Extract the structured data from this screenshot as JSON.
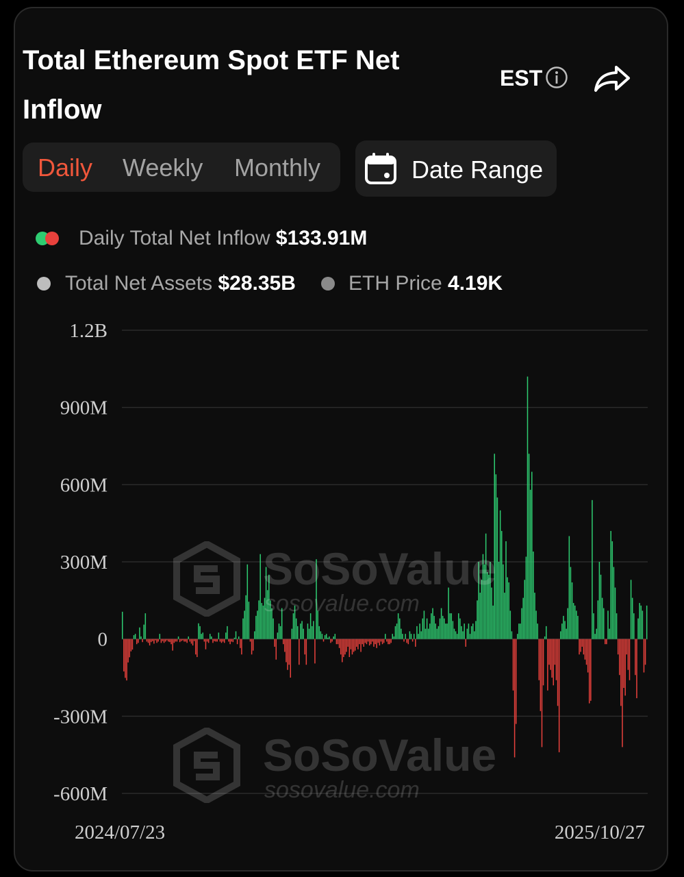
{
  "header": {
    "title": "Total Ethereum Spot ETF Net Inflow",
    "timezone": "EST"
  },
  "controls": {
    "periods": [
      "Daily",
      "Weekly",
      "Monthly"
    ],
    "active_period": "Daily",
    "date_range_label": "Date Range"
  },
  "legend": {
    "net_inflow_label": "Daily Total Net Inflow",
    "net_inflow_value": "$133.91M",
    "assets_label": "Total Net Assets",
    "assets_value": "$28.35B",
    "price_label": "ETH Price",
    "price_value": "4.19K"
  },
  "watermark": {
    "brand": "SoSoValue",
    "site": "sosovalue.com"
  },
  "colors": {
    "positive": "#2ecc71",
    "negative": "#e8413c",
    "accent": "#f0573b"
  },
  "chart_data": {
    "type": "bar",
    "ylim": [
      -600000000,
      1200000000
    ],
    "y_ticks": [
      {
        "value": 1200000000,
        "label": "1.2B"
      },
      {
        "value": 900000000,
        "label": "900M"
      },
      {
        "value": 600000000,
        "label": "600M"
      },
      {
        "value": 300000000,
        "label": "300M"
      },
      {
        "value": 0,
        "label": "0"
      },
      {
        "value": -300000000,
        "label": "-300M"
      },
      {
        "value": -600000000,
        "label": "-600M"
      }
    ],
    "x_start": "2024/07/23",
    "x_end": "2025/10/27",
    "grid": true,
    "values": [
      106,
      -126,
      -151,
      -161,
      -91,
      -71,
      -48,
      -41,
      15,
      20,
      -20,
      -15,
      45,
      10,
      -12,
      56,
      100,
      -10,
      -15,
      -25,
      -12,
      -8,
      -18,
      -5,
      -15,
      -10,
      20,
      -15,
      -8,
      -15,
      -10,
      -5,
      -10,
      -12,
      -20,
      -45,
      -15,
      -10,
      -10,
      10,
      -12,
      -8,
      -5,
      -10,
      -10,
      -15,
      10,
      -10,
      -18,
      -25,
      -8,
      -60,
      -70,
      61,
      50,
      20,
      25,
      -10,
      -40,
      -10,
      -15,
      20,
      10,
      -15,
      -8,
      -10,
      -10,
      25,
      -10,
      -15,
      -10,
      -15,
      25,
      50,
      -10,
      -20,
      -10,
      -12,
      5,
      30,
      -20,
      10,
      -35,
      -60,
      80,
      110,
      170,
      290,
      145,
      -10,
      -60,
      -45,
      30,
      90,
      110,
      150,
      330,
      140,
      130,
      160,
      280,
      190,
      250,
      150,
      120,
      80,
      -30,
      -80,
      25,
      60,
      50,
      120,
      -20,
      -50,
      -90,
      -120,
      -100,
      -150,
      40,
      100,
      130,
      80,
      50,
      -100,
      60,
      70,
      40,
      -60,
      -100,
      60,
      40,
      100,
      50,
      70,
      -95,
      310,
      110,
      50,
      30,
      20,
      -10,
      15,
      20,
      5,
      10,
      -15,
      -10,
      10,
      20,
      -20,
      -20,
      -35,
      -60,
      -90,
      -70,
      -60,
      -50,
      -30,
      -70,
      -40,
      -60,
      -50,
      -45,
      -30,
      -40,
      -20,
      -50,
      -20,
      -30,
      -15,
      -20,
      -10,
      -25,
      -20,
      -10,
      -30,
      -20,
      -35,
      -15,
      -25,
      -10,
      -20,
      -15,
      20,
      -10,
      -20,
      -20,
      -15,
      20,
      10,
      50,
      60,
      100,
      80,
      40,
      20,
      -10,
      20,
      -15,
      -20,
      30,
      20,
      -10,
      20,
      -30,
      50,
      20,
      60,
      30,
      80,
      110,
      40,
      80,
      40,
      60,
      100,
      120,
      90,
      60,
      40,
      50,
      80,
      120,
      90,
      80,
      60,
      60,
      200,
      100,
      100,
      70,
      40,
      30,
      20,
      100,
      80,
      50,
      30,
      60,
      -30,
      40,
      60,
      20,
      50,
      60,
      30,
      70,
      150,
      300,
      180,
      230,
      330,
      290,
      410,
      260,
      250,
      300,
      200,
      130,
      720,
      640,
      550,
      300,
      500,
      420,
      290,
      180,
      380,
      240,
      220,
      110,
      30,
      -200,
      -460,
      -330,
      20,
      60,
      60,
      120,
      160,
      230,
      320,
      1020,
      720,
      580,
      650,
      340,
      180,
      110,
      60,
      -160,
      -280,
      -420,
      -180,
      10,
      50,
      -200,
      -100,
      -120,
      -150,
      -180,
      -100,
      -160,
      -260,
      -440,
      30,
      60,
      90,
      70,
      40,
      120,
      400,
      280,
      220,
      140,
      130,
      110,
      90,
      -60,
      -50,
      -30,
      -60,
      -80,
      -100,
      -130,
      -250,
      -240,
      540,
      100,
      20,
      40,
      150,
      300,
      250,
      160,
      120,
      -20,
      -20,
      110,
      40,
      420,
      380,
      280,
      200,
      100,
      -60,
      -140,
      -260,
      -420,
      -190,
      -220,
      -60,
      -120,
      -160,
      230,
      160,
      100,
      -140,
      -230,
      80,
      140,
      130,
      110,
      -130,
      -100,
      130
    ]
  }
}
